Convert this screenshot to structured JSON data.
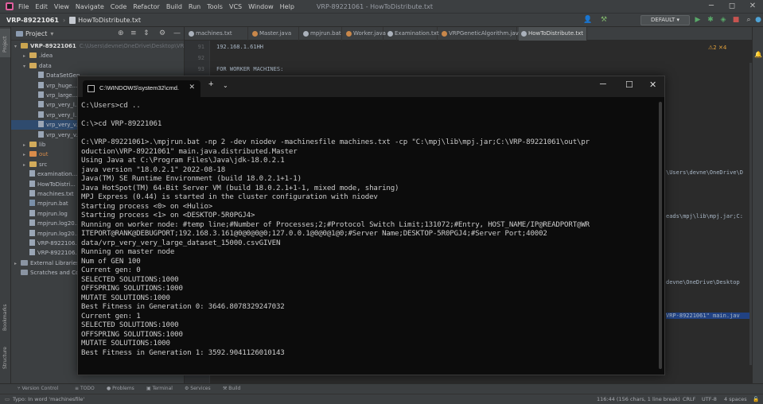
{
  "window": {
    "title": "VRP-89221061 - HowToDistribute.txt",
    "min": "─",
    "max": "◻",
    "close": "✕"
  },
  "menu": [
    "File",
    "Edit",
    "View",
    "Navigate",
    "Code",
    "Refactor",
    "Build",
    "Run",
    "Tools",
    "VCS",
    "Window",
    "Help"
  ],
  "breadcrumb": {
    "project": "VRP-89221061",
    "file": "HowToDistribute.txt"
  },
  "toolbar": {
    "run_config": "DEFAULT"
  },
  "project_panel": {
    "title": "Project",
    "tree": [
      {
        "label": "VRP-89221061",
        "hint": "C:\\Users\\devne\\OneDrive\\Desktop\\VRP-89221061",
        "indent": 0,
        "type": "root",
        "arrow": "▾"
      },
      {
        "label": ".idea",
        "indent": 1,
        "type": "folder",
        "arrow": "▸"
      },
      {
        "label": "data",
        "indent": 1,
        "type": "folder",
        "arrow": "▾"
      },
      {
        "label": "DataSetGen...",
        "indent": 2,
        "type": "file",
        "arrow": ""
      },
      {
        "label": "vrp_huge...",
        "indent": 2,
        "type": "file",
        "arrow": ""
      },
      {
        "label": "vrp_large...",
        "indent": 2,
        "type": "file",
        "arrow": ""
      },
      {
        "label": "vrp_very_l...",
        "indent": 2,
        "type": "file",
        "arrow": ""
      },
      {
        "label": "vrp_very_l...",
        "indent": 2,
        "type": "file",
        "arrow": ""
      },
      {
        "label": "vrp_very_v...",
        "indent": 2,
        "type": "file",
        "arrow": "",
        "selected": true
      },
      {
        "label": "vrp_very_v...",
        "indent": 2,
        "type": "file",
        "arrow": ""
      },
      {
        "label": "lib",
        "indent": 1,
        "type": "folder",
        "arrow": "▸"
      },
      {
        "label": "out",
        "indent": 1,
        "type": "folder-orange",
        "arrow": "▸"
      },
      {
        "label": "src",
        "indent": 1,
        "type": "folder",
        "arrow": "▸"
      },
      {
        "label": "examination...",
        "indent": 1,
        "type": "file",
        "arrow": ""
      },
      {
        "label": "HowToDistri...",
        "indent": 1,
        "type": "file",
        "arrow": ""
      },
      {
        "label": "machines.txt",
        "indent": 1,
        "type": "file",
        "arrow": ""
      },
      {
        "label": "mpjrun.bat",
        "indent": 1,
        "type": "bat",
        "arrow": ""
      },
      {
        "label": "mpjrun.log",
        "indent": 1,
        "type": "file",
        "arrow": ""
      },
      {
        "label": "mpjrun.log20...",
        "indent": 1,
        "type": "file",
        "arrow": ""
      },
      {
        "label": "mpjrun.log20...",
        "indent": 1,
        "type": "file",
        "arrow": ""
      },
      {
        "label": "VRP-8922106...",
        "indent": 1,
        "type": "file",
        "arrow": ""
      },
      {
        "label": "VRP-8922106...",
        "indent": 1,
        "type": "file",
        "arrow": ""
      },
      {
        "label": "External Libraries",
        "indent": 0,
        "type": "lib",
        "arrow": "▸"
      },
      {
        "label": "Scratches and Co...",
        "indent": 0,
        "type": "lib",
        "arrow": ""
      }
    ]
  },
  "tabs": [
    "machines.txt",
    "Master.java",
    "mpjrun.bat",
    "Worker.java",
    "Examination.txt",
    "VRPGeneticAlgorithm.java",
    "HowToDistribute.txt"
  ],
  "editor": {
    "lines": [
      {
        "n": "91",
        "t": "192.168.1.61HH"
      },
      {
        "n": "92",
        "t": ""
      },
      {
        "n": "93",
        "t": "FOR WORKER MACHINES:"
      }
    ],
    "right_fragments": [
      "\\Users\\devne\\OneDrive\\D",
      "eads\\mpj\\lib\\mpj.jar;C:",
      "devne\\OneDrive\\Desktop",
      "VRP-89221061\" main.jav"
    ],
    "warnings": "⚠2 ✕4"
  },
  "cmd": {
    "tab_title": "C:\\WINDOWS\\system32\\cmd.",
    "lines": [
      "C:\\Users>cd ..",
      "",
      "C:\\>cd VRP-89221061",
      "",
      "C:\\VRP-89221061>.\\mpjrun.bat -np 2 -dev niodev -machinesfile machines.txt -cp \"C:\\mpj\\lib\\mpj.jar;C:\\VRP-89221061\\out\\pr",
      "oduction\\VRP-89221061\" main.java.distributed.Master",
      "Using Java at C:\\Program Files\\Java\\jdk-18.0.2.1",
      "java version \"18.0.2.1\" 2022-08-18",
      "Java(TM) SE Runtime Environment (build 18.0.2.1+1-1)",
      "Java HotSpot(TM) 64-Bit Server VM (build 18.0.2.1+1-1, mixed mode, sharing)",
      "MPJ Express (0.44) is started in the cluster configuration with niodev",
      "Starting process <0> on <Hulio>",
      "Starting process <1> on <DESKTOP-5R0PGJ4>",
      "Running on worker node: #temp line;#Number of Processes;2;#Protocol Switch Limit;131072;#Entry, HOST_NAME/IP@READPORT@WR",
      "ITEPORT@RANK@DEBUGPORT;192.168.3.161@0@0@0@0;127.0.0.1@0@0@1@0;#Server Name;DESKTOP-5R0PGJ4;#Server Port;40002",
      "data/vrp_very_very_large_dataset_15000.csvGIVEN",
      "Running on master node",
      "Num of GEN 100",
      "Current gen: 0",
      "SELECTED SOLUTIONS:1000",
      "OFFSPRING SOLUTIONS:1000",
      "MUTATE SOLUTIONS:1000",
      "Best Fitness in Generation 0: 3646.8078329247032",
      "Current gen: 1",
      "SELECTED SOLUTIONS:1000",
      "OFFSPRING SOLUTIONS:1000",
      "MUTATE SOLUTIONS:1000",
      "Best Fitness in Generation 1: 3592.9041126010143"
    ]
  },
  "tool_tabs": [
    "Version Control",
    "TODO",
    "Problems",
    "Terminal",
    "Services",
    "Build"
  ],
  "left_tool": [
    "Project",
    "Bookmarks",
    "Structure"
  ],
  "status": {
    "hint": "Typo: In word 'machinesfile'",
    "position": "116:44 (156 chars, 1 line break)",
    "line_sep": "CRLF",
    "encoding": "UTF-8",
    "indent": "4 spaces"
  }
}
